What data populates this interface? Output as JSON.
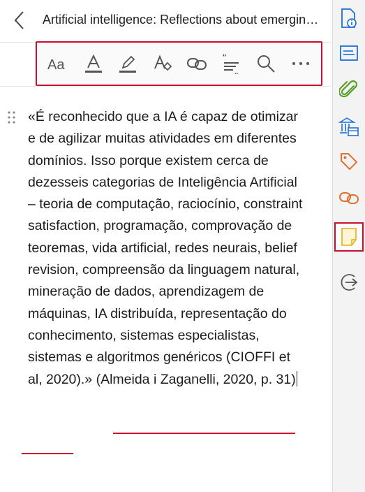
{
  "header": {
    "title": "Artificial intelligence: Reflections about emerging..."
  },
  "toolbar": {
    "items": [
      {
        "name": "font-style-icon"
      },
      {
        "name": "text-color-icon"
      },
      {
        "name": "highlight-icon"
      },
      {
        "name": "clear-formatting-icon"
      },
      {
        "name": "link-icon"
      },
      {
        "name": "quote-icon"
      },
      {
        "name": "search-icon"
      },
      {
        "name": "more-icon"
      }
    ]
  },
  "content": {
    "quote": "«É reconhecido que a IA é capaz de otimizar e de agilizar muitas atividades em diferentes domínios. Isso porque existem cerca de dezesseis categorias de Inteligência Artificial – teoria de computação, raciocínio, constraint satisfaction, programação, comprovação de teoremas, vida artificial, redes neurais, belief revision, compreensão da linguagem natural, mineração de dados, aprendizagem de máquinas, IA distribuída, representação do conhecimento, sistemas especialistas, sistemas e algoritmos genéricos (CIOFFI et al, 2020).»",
    "citation": "(Almeida i Zaganelli, 2020, p. 31)"
  },
  "sidebar": {
    "items": [
      {
        "name": "document-info-icon"
      },
      {
        "name": "notes-icon"
      },
      {
        "name": "attachments-icon"
      },
      {
        "name": "library-icon"
      },
      {
        "name": "tags-icon"
      },
      {
        "name": "related-links-icon"
      },
      {
        "name": "annotation-note-icon",
        "active": true
      },
      {
        "name": "locate-icon"
      }
    ]
  },
  "colors": {
    "accent_red": "#c8102e",
    "blue": "#1e6fd9",
    "green": "#5aa02c",
    "orange": "#e07030",
    "yellow": "#f2b428"
  }
}
